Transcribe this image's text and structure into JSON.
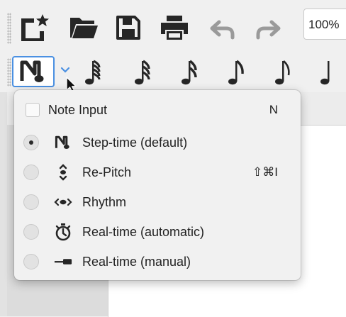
{
  "toolbar": {
    "zoom_value": "100%",
    "icons": [
      "new-score-icon",
      "open-folder-icon",
      "save-icon",
      "print-icon",
      "undo-icon",
      "redo-icon"
    ]
  },
  "note_toolbar": {
    "note_input_icon": "note-input-icon",
    "notes": [
      "64th-note-icon",
      "32nd-note-icon",
      "16th-note-icon",
      "8th-note-icon",
      "8th-note-icon",
      "quarter-note-icon"
    ]
  },
  "menu": {
    "header": {
      "label": "Note Input",
      "shortcut": "N",
      "checked": false
    },
    "items": [
      {
        "label": "Step-time (default)",
        "icon": "step-time-icon",
        "shortcut": "",
        "selected": true
      },
      {
        "label": "Re-Pitch",
        "icon": "re-pitch-icon",
        "shortcut": "⇧⌘I",
        "selected": false
      },
      {
        "label": "Rhythm",
        "icon": "rhythm-icon",
        "shortcut": "",
        "selected": false
      },
      {
        "label": "Real-time (automatic)",
        "icon": "stopwatch-icon",
        "shortcut": "",
        "selected": false
      },
      {
        "label": "Real-time (manual)",
        "icon": "manual-time-icon",
        "shortcut": "",
        "selected": false
      }
    ]
  },
  "colors": {
    "accent": "#4a90e2",
    "icon": "#262626",
    "disabled_icon": "#9a9a9a"
  }
}
